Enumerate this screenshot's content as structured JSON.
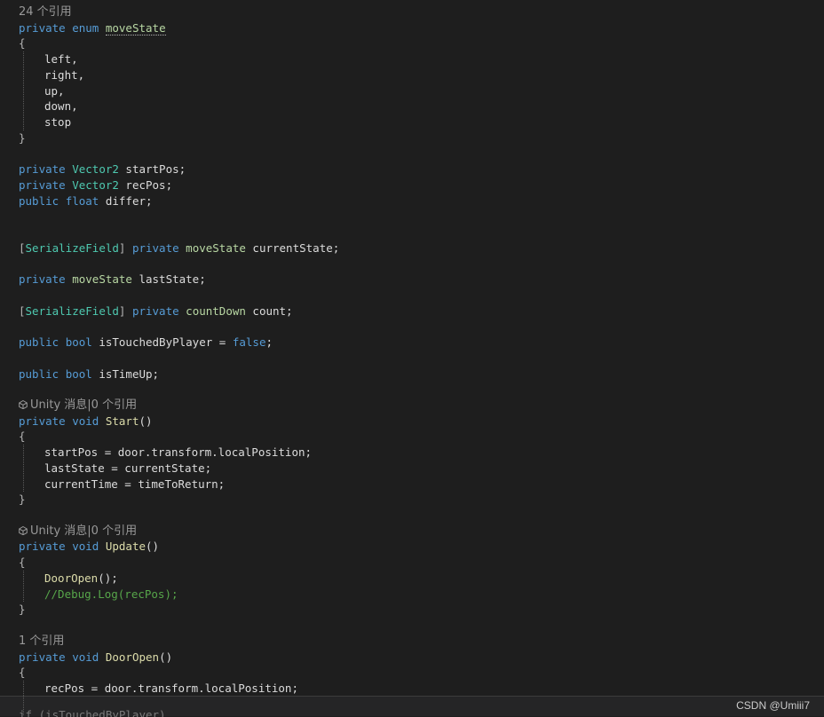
{
  "lines": [
    {
      "kind": "lens",
      "text": "24 个引用"
    },
    {
      "tokens": [
        {
          "t": "private",
          "c": "kw"
        },
        {
          "t": " "
        },
        {
          "t": "enum",
          "c": "kw"
        },
        {
          "t": " "
        },
        {
          "t": "moveState",
          "c": "enum",
          "sq": true
        }
      ]
    },
    {
      "tokens": [
        {
          "t": "{",
          "c": "punct"
        }
      ]
    },
    {
      "indent": 1,
      "tokens": [
        {
          "t": "left,",
          "c": "plain"
        }
      ]
    },
    {
      "indent": 1,
      "tokens": [
        {
          "t": "right,",
          "c": "plain"
        }
      ]
    },
    {
      "indent": 1,
      "tokens": [
        {
          "t": "up,",
          "c": "plain"
        }
      ]
    },
    {
      "indent": 1,
      "tokens": [
        {
          "t": "down,",
          "c": "plain"
        }
      ]
    },
    {
      "indent": 1,
      "tokens": [
        {
          "t": "stop",
          "c": "plain"
        }
      ]
    },
    {
      "tokens": [
        {
          "t": "}",
          "c": "punct"
        }
      ]
    },
    {
      "tokens": []
    },
    {
      "tokens": [
        {
          "t": "private",
          "c": "kw"
        },
        {
          "t": " "
        },
        {
          "t": "Vector2",
          "c": "type"
        },
        {
          "t": " startPos;",
          "c": "plain"
        }
      ]
    },
    {
      "tokens": [
        {
          "t": "private",
          "c": "kw"
        },
        {
          "t": " "
        },
        {
          "t": "Vector2",
          "c": "type"
        },
        {
          "t": " recPos;",
          "c": "plain"
        }
      ]
    },
    {
      "tokens": [
        {
          "t": "public",
          "c": "kw"
        },
        {
          "t": " "
        },
        {
          "t": "float",
          "c": "kw"
        },
        {
          "t": " differ;",
          "c": "plain"
        }
      ]
    },
    {
      "tokens": []
    },
    {
      "tokens": []
    },
    {
      "tokens": [
        {
          "t": "[",
          "c": "punct"
        },
        {
          "t": "SerializeField",
          "c": "attr"
        },
        {
          "t": "]",
          "c": "punct"
        },
        {
          "t": " "
        },
        {
          "t": "private",
          "c": "kw"
        },
        {
          "t": " "
        },
        {
          "t": "moveState",
          "c": "enum"
        },
        {
          "t": " currentState;",
          "c": "plain"
        }
      ]
    },
    {
      "tokens": []
    },
    {
      "tokens": [
        {
          "t": "private",
          "c": "kw"
        },
        {
          "t": " "
        },
        {
          "t": "moveState",
          "c": "enum"
        },
        {
          "t": " lastState;",
          "c": "plain"
        }
      ]
    },
    {
      "tokens": []
    },
    {
      "tokens": [
        {
          "t": "[",
          "c": "punct"
        },
        {
          "t": "SerializeField",
          "c": "attr"
        },
        {
          "t": "]",
          "c": "punct"
        },
        {
          "t": " "
        },
        {
          "t": "private",
          "c": "kw"
        },
        {
          "t": " "
        },
        {
          "t": "countDown",
          "c": "enum"
        },
        {
          "t": " count;",
          "c": "plain"
        }
      ]
    },
    {
      "tokens": []
    },
    {
      "tokens": [
        {
          "t": "public",
          "c": "kw"
        },
        {
          "t": " "
        },
        {
          "t": "bool",
          "c": "kw"
        },
        {
          "t": " isTouchedByPlayer = ",
          "c": "plain"
        },
        {
          "t": "false",
          "c": "kw"
        },
        {
          "t": ";",
          "c": "plain"
        }
      ]
    },
    {
      "tokens": []
    },
    {
      "tokens": [
        {
          "t": "public",
          "c": "kw"
        },
        {
          "t": " "
        },
        {
          "t": "bool",
          "c": "kw"
        },
        {
          "t": " isTimeUp;",
          "c": "plain"
        }
      ]
    },
    {
      "tokens": []
    },
    {
      "kind": "lens",
      "icon": "unity-icon",
      "text": "Unity 消息|0 个引用"
    },
    {
      "tokens": [
        {
          "t": "private",
          "c": "kw"
        },
        {
          "t": " "
        },
        {
          "t": "void",
          "c": "kw"
        },
        {
          "t": " "
        },
        {
          "t": "Start",
          "c": "method"
        },
        {
          "t": "()",
          "c": "plain"
        }
      ]
    },
    {
      "tokens": [
        {
          "t": "{",
          "c": "punct"
        }
      ]
    },
    {
      "indent": 1,
      "tokens": [
        {
          "t": "startPos = door.transform.localPosition;",
          "c": "plain"
        }
      ]
    },
    {
      "indent": 1,
      "tokens": [
        {
          "t": "lastState = currentState;",
          "c": "plain"
        }
      ]
    },
    {
      "indent": 1,
      "tokens": [
        {
          "t": "currentTime = timeToReturn;",
          "c": "plain"
        }
      ]
    },
    {
      "tokens": [
        {
          "t": "}",
          "c": "punct"
        }
      ]
    },
    {
      "tokens": []
    },
    {
      "kind": "lens",
      "icon": "unity-icon",
      "text": "Unity 消息|0 个引用"
    },
    {
      "tokens": [
        {
          "t": "private",
          "c": "kw"
        },
        {
          "t": " "
        },
        {
          "t": "void",
          "c": "kw"
        },
        {
          "t": " "
        },
        {
          "t": "Update",
          "c": "method"
        },
        {
          "t": "()",
          "c": "plain"
        }
      ]
    },
    {
      "tokens": [
        {
          "t": "{",
          "c": "punct"
        }
      ]
    },
    {
      "indent": 1,
      "tokens": [
        {
          "t": "DoorOpen",
          "c": "method"
        },
        {
          "t": "();",
          "c": "plain"
        }
      ]
    },
    {
      "indent": 1,
      "tokens": [
        {
          "t": "//Debug.Log(recPos);",
          "c": "comment"
        }
      ]
    },
    {
      "tokens": [
        {
          "t": "}",
          "c": "punct"
        }
      ]
    },
    {
      "tokens": []
    },
    {
      "kind": "lens",
      "text": "1 个引用"
    },
    {
      "tokens": [
        {
          "t": "private",
          "c": "kw"
        },
        {
          "t": " "
        },
        {
          "t": "void",
          "c": "kw"
        },
        {
          "t": " "
        },
        {
          "t": "DoorOpen",
          "c": "method"
        },
        {
          "t": "()",
          "c": "plain"
        }
      ]
    },
    {
      "tokens": [
        {
          "t": "{",
          "c": "punct"
        }
      ]
    },
    {
      "indent": 1,
      "tokens": [
        {
          "t": "recPos = door.transform.localPosition;",
          "c": "plain"
        }
      ]
    }
  ],
  "partial_line": "if (isTouchedByPlayer)",
  "watermark": "CSDN @Umiii7"
}
